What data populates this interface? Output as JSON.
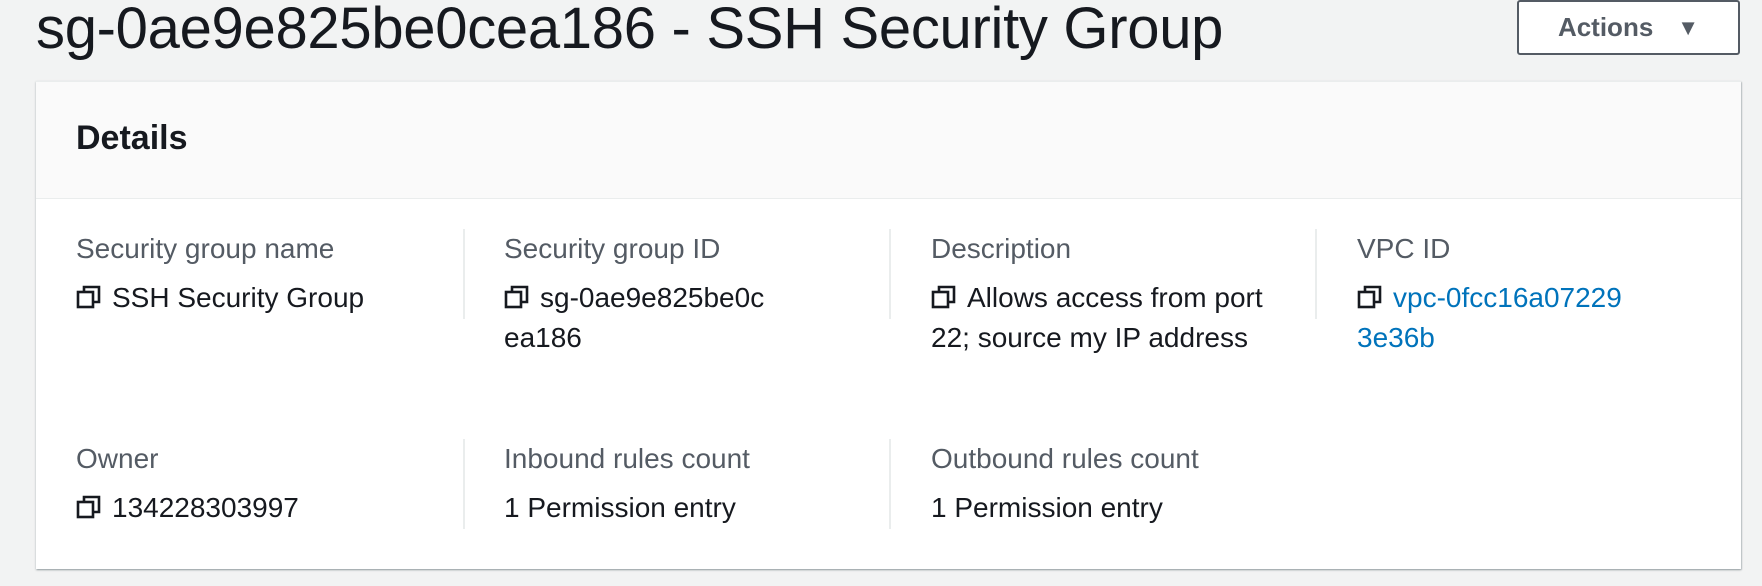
{
  "header": {
    "title": "sg-0ae9e825be0cea186 - SSH Security Group",
    "actions_label": "Actions"
  },
  "details": {
    "title": "Details",
    "fields": [
      {
        "label": "Security group name",
        "value": "SSH Security Group",
        "copyable": true,
        "link": false
      },
      {
        "label": "Security group ID",
        "value": "sg-0ae9e825be0cea186",
        "copyable": true,
        "link": false
      },
      {
        "label": "Description",
        "value": "Allows access from port 22; source my IP address",
        "copyable": true,
        "link": false
      },
      {
        "label": "VPC ID",
        "value": "vpc-0fcc16a072293e36b",
        "copyable": true,
        "link": true
      },
      {
        "label": "Owner",
        "value": "134228303997",
        "copyable": true,
        "link": false
      },
      {
        "label": "Inbound rules count",
        "value": "1 Permission entry",
        "copyable": false,
        "link": false
      },
      {
        "label": "Outbound rules count",
        "value": "1 Permission entry",
        "copyable": false,
        "link": false
      }
    ]
  },
  "icons": {
    "copy": "copy-icon",
    "caret": "caret-down-icon"
  },
  "colors": {
    "link": "#0073bb",
    "label": "#545b64",
    "text": "#16191f",
    "background": "#f2f3f3"
  }
}
